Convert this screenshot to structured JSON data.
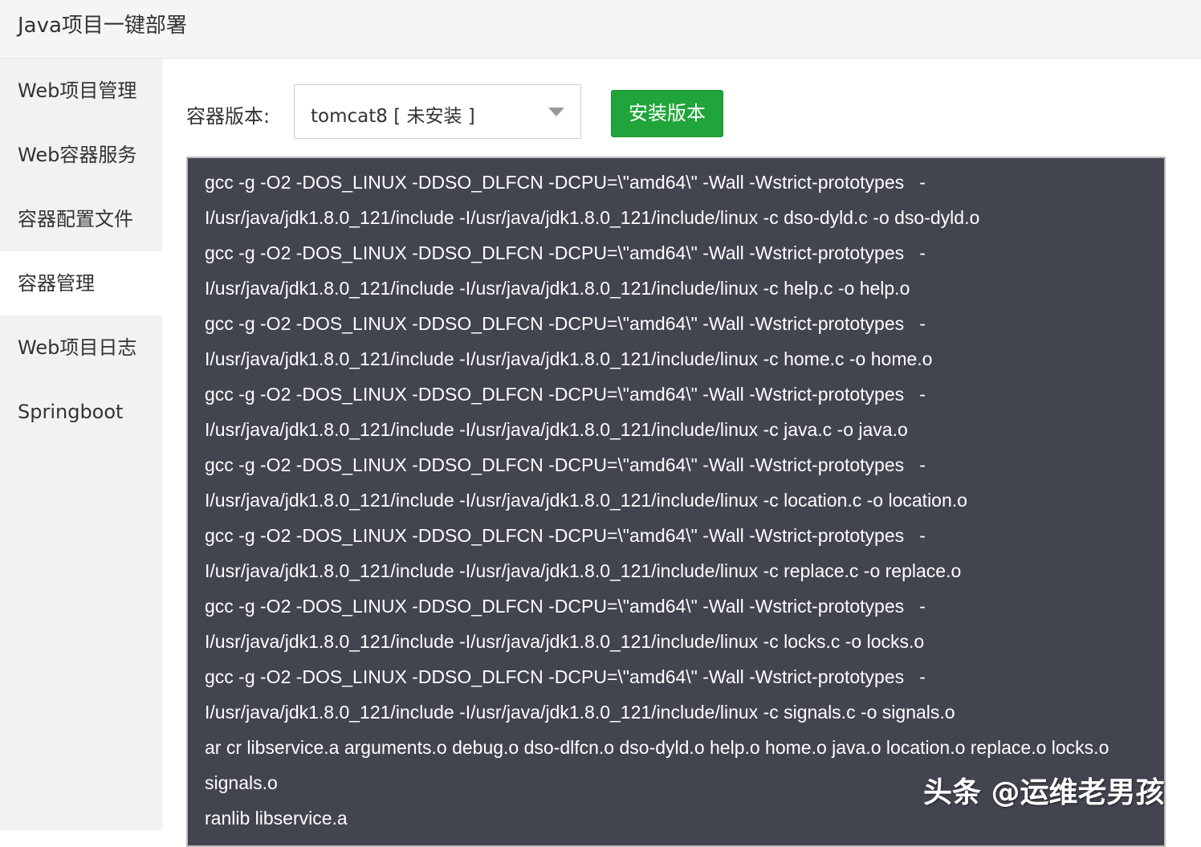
{
  "app": {
    "title": "Java项目一键部署"
  },
  "sidebar": {
    "items": [
      {
        "label": "Web项目管理"
      },
      {
        "label": "Web容器服务"
      },
      {
        "label": "容器配置文件"
      },
      {
        "label": "容器管理",
        "active": true
      },
      {
        "label": "Web项目日志"
      },
      {
        "label": "Springboot"
      }
    ]
  },
  "main": {
    "container_label": "容器版本:",
    "container_select": {
      "value": "tomcat8 [ 未安装 ]"
    },
    "install_button": "安装版本",
    "console_lines": [
      "gcc -g -O2 -DOS_LINUX -DDSO_DLFCN -DCPU=\\\"amd64\\\" -Wall -Wstrict-prototypes   -",
      "I/usr/java/jdk1.8.0_121/include -I/usr/java/jdk1.8.0_121/include/linux -c dso-dyld.c -o dso-dyld.o",
      "gcc -g -O2 -DOS_LINUX -DDSO_DLFCN -DCPU=\\\"amd64\\\" -Wall -Wstrict-prototypes   -",
      "I/usr/java/jdk1.8.0_121/include -I/usr/java/jdk1.8.0_121/include/linux -c help.c -o help.o",
      "gcc -g -O2 -DOS_LINUX -DDSO_DLFCN -DCPU=\\\"amd64\\\" -Wall -Wstrict-prototypes   -",
      "I/usr/java/jdk1.8.0_121/include -I/usr/java/jdk1.8.0_121/include/linux -c home.c -o home.o",
      "gcc -g -O2 -DOS_LINUX -DDSO_DLFCN -DCPU=\\\"amd64\\\" -Wall -Wstrict-prototypes   -",
      "I/usr/java/jdk1.8.0_121/include -I/usr/java/jdk1.8.0_121/include/linux -c java.c -o java.o",
      "gcc -g -O2 -DOS_LINUX -DDSO_DLFCN -DCPU=\\\"amd64\\\" -Wall -Wstrict-prototypes   -",
      "I/usr/java/jdk1.8.0_121/include -I/usr/java/jdk1.8.0_121/include/linux -c location.c -o location.o",
      "gcc -g -O2 -DOS_LINUX -DDSO_DLFCN -DCPU=\\\"amd64\\\" -Wall -Wstrict-prototypes   -",
      "I/usr/java/jdk1.8.0_121/include -I/usr/java/jdk1.8.0_121/include/linux -c replace.c -o replace.o",
      "gcc -g -O2 -DOS_LINUX -DDSO_DLFCN -DCPU=\\\"amd64\\\" -Wall -Wstrict-prototypes   -",
      "I/usr/java/jdk1.8.0_121/include -I/usr/java/jdk1.8.0_121/include/linux -c locks.c -o locks.o",
      "gcc -g -O2 -DOS_LINUX -DDSO_DLFCN -DCPU=\\\"amd64\\\" -Wall -Wstrict-prototypes   -",
      "I/usr/java/jdk1.8.0_121/include -I/usr/java/jdk1.8.0_121/include/linux -c signals.c -o signals.o",
      "ar cr libservice.a arguments.o debug.o dso-dlfcn.o dso-dyld.o help.o home.o java.o location.o replace.o locks.o",
      "signals.o",
      "ranlib libservice.a"
    ]
  },
  "watermark": "头条 @运维老男孩",
  "colors": {
    "accent_green": "#20a53a",
    "console_bg": "#424450",
    "sidebar_bg": "#f2f2f2",
    "titlebar_bg": "#f5f5f5"
  }
}
